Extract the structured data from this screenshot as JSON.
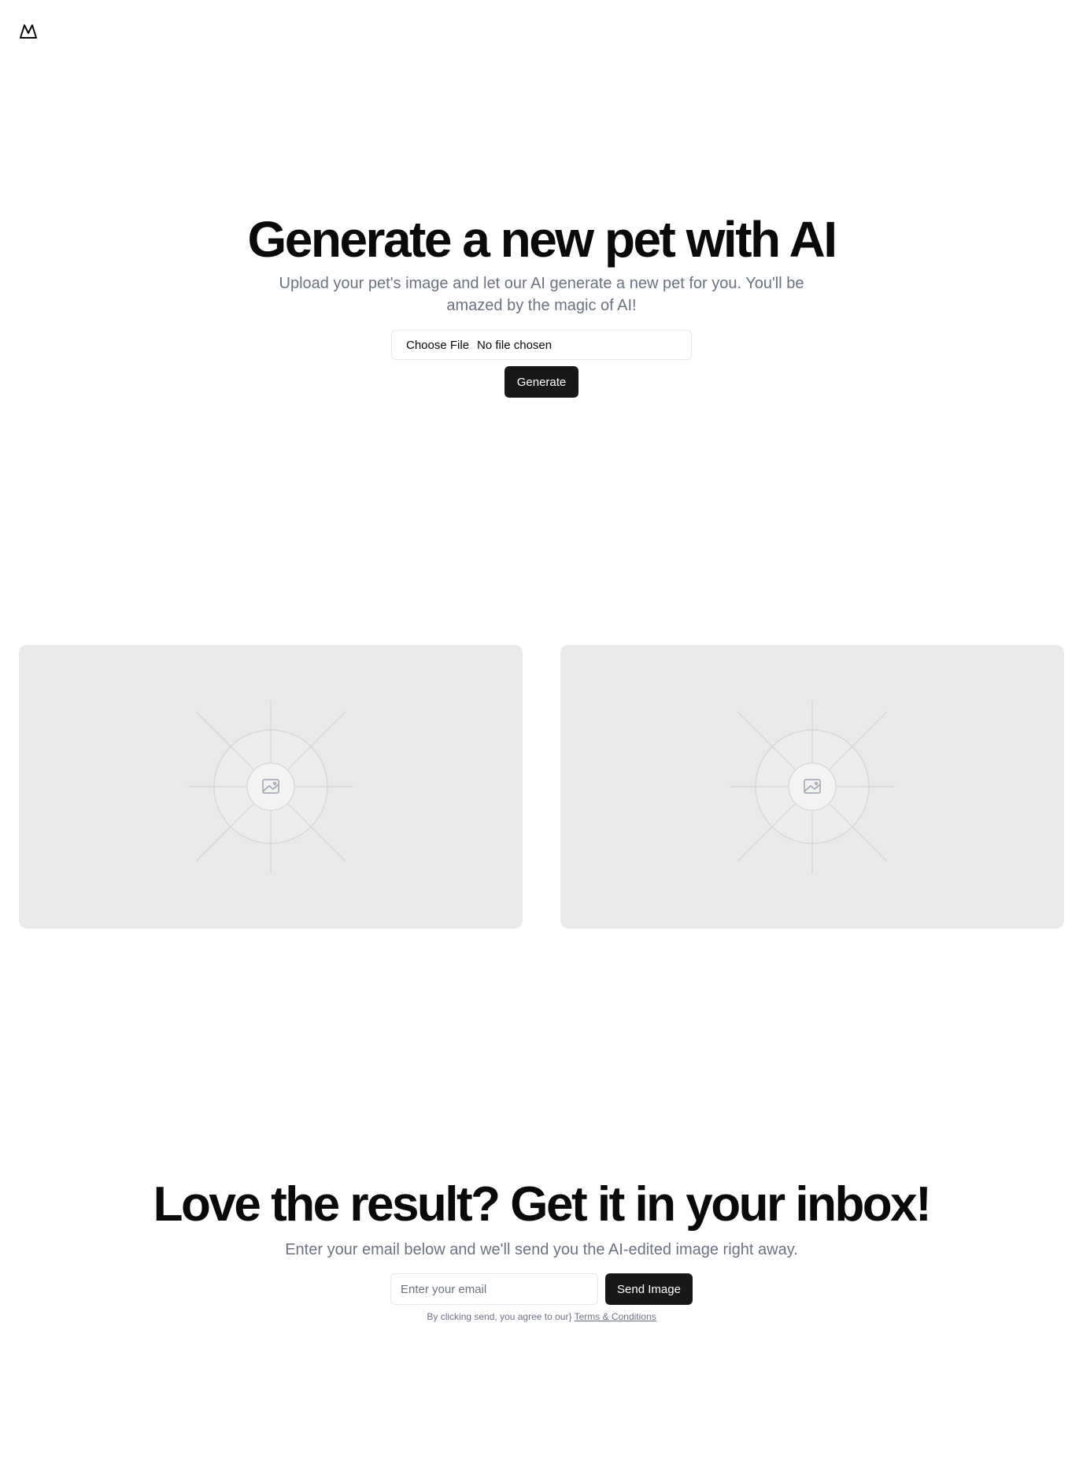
{
  "header": {
    "logo_icon": "mountain-logo-icon"
  },
  "hero": {
    "title": "Generate a new pet with AI",
    "subtitle": "Upload your pet's image and let our AI generate a new pet for you. You'll be amazed by the magic of AI!",
    "file_button_label": "Choose File",
    "file_status": "No file chosen",
    "generate_label": "Generate"
  },
  "previews": {
    "left_icon": "image-placeholder-icon",
    "right_icon": "image-placeholder-icon"
  },
  "cta": {
    "title": "Love the result? Get it in your inbox!",
    "subtitle": "Enter your email below and we'll send you the AI-edited image right away.",
    "email_placeholder": "Enter your email",
    "email_value": "",
    "send_label": "Send Image",
    "terms_prefix": "By clicking send, you agree to our} ",
    "terms_link": "Terms & Conditions"
  },
  "colors": {
    "button_bg": "#18181b",
    "muted_text": "#6b7280",
    "card_bg": "#e9e9e9"
  }
}
